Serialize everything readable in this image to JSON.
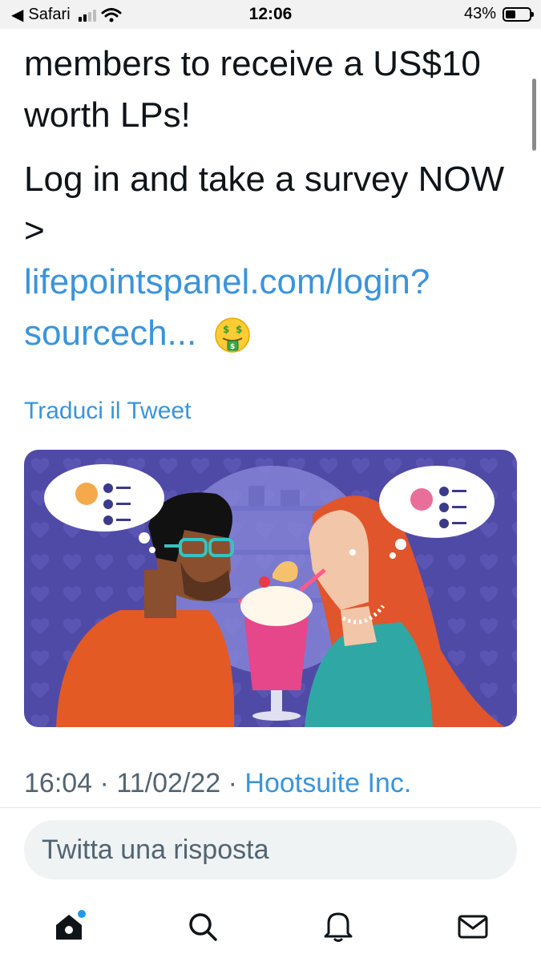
{
  "status_bar": {
    "back_app": "Safari",
    "time": "12:06",
    "battery": "43%",
    "battery_level": 0.43
  },
  "tweet": {
    "line_partial": "members to receive a US$10 worth LPs!",
    "line_cta": "Log in and take a survey NOW >",
    "link_text": "lifepointspanel.com/login?sourcech...",
    "emoji": "money-mouth-face",
    "translate": "Traduci il Tweet"
  },
  "meta": {
    "time": "16:04",
    "separator1": "·",
    "date": "11/02/22",
    "separator2": "·",
    "source": "Hootsuite Inc."
  },
  "reply": {
    "placeholder": "Twitta una risposta"
  },
  "tabbar": {
    "items": [
      "home-icon",
      "search-icon",
      "notifications-icon",
      "messages-icon"
    ],
    "home_badge_color": "#1d9bf0"
  },
  "colors": {
    "link": "#3b94d9",
    "illustration_bg": "#4f4aa6",
    "text": "#0f1419"
  }
}
